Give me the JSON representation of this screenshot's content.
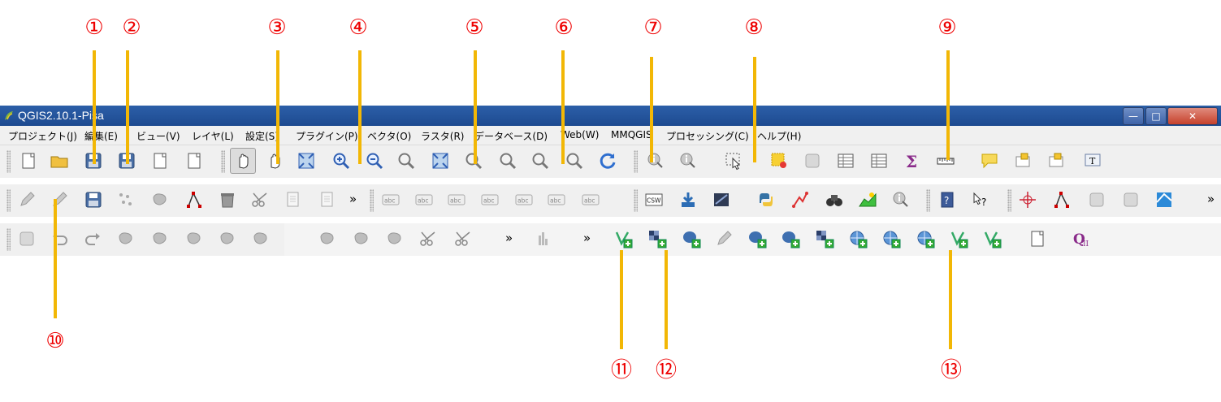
{
  "window": {
    "title": "QGIS2.10.1-Pisa",
    "controls": {
      "minimize": "—",
      "restore": "□",
      "close": "✕"
    }
  },
  "menubar": [
    "プロジェクト(J)",
    "編集(E)",
    "ビュー(V)",
    "レイヤ(L)",
    "設定(S)",
    "プラグイン(P)",
    "ベクタ(O)",
    "ラスタ(R)",
    "データベース(D)",
    "Web(W)",
    "MMQGIS",
    "プロセッシング(C)",
    "ヘルプ(H)"
  ],
  "callouts": {
    "top": [
      "①",
      "②",
      "③",
      "④",
      "⑤",
      "⑥",
      "⑦",
      "⑧",
      "⑨"
    ],
    "bottom": [
      "⑩",
      "⑪",
      "⑫",
      "⑬"
    ]
  },
  "toolbar": {
    "more_glyph": "»"
  },
  "icons": {
    "row1": [
      "new-project-icon",
      "open-project-icon",
      "save-project-icon",
      "save-as-icon",
      "new-print-composer-icon",
      "composer-manager-icon",
      "touch-zoom-icon",
      "pan-icon",
      "pan-to-selection-icon",
      "zoom-in-icon",
      "zoom-out-icon",
      "zoom-actual-icon",
      "zoom-full-icon",
      "zoom-to-selection-icon",
      "zoom-to-layer-icon",
      "zoom-last-icon",
      "zoom-next-icon",
      "refresh-icon",
      "identify-icon",
      "run-action-icon",
      "select-icon",
      "deselect-icon",
      "select-by-expression-icon",
      "attribute-table-icon",
      "field-calculator-icon",
      "statistics-icon",
      "measure-icon",
      "map-tips-icon",
      "new-bookmark-icon",
      "show-bookmarks-icon",
      "text-annotation-icon"
    ],
    "row2": [
      "edit-pencil-icon",
      "toggle-editing-icon",
      "save-edits-icon",
      "add-feature-icon",
      "move-feature-icon",
      "node-tool-icon",
      "delete-selected-icon",
      "cut-features-icon",
      "copy-features-icon",
      "paste-features-icon",
      "label-icon",
      "pin-label-icon",
      "highlight-pinned-icon",
      "show-hide-label-icon",
      "move-label-icon",
      "rotate-label-icon",
      "change-label-icon",
      "csw-icon",
      "ogr-converter-icon",
      "georeferencer-icon",
      "python-console-icon",
      "gps-tool-icon",
      "road-graph-icon",
      "profile-tool-icon",
      "qgis-identify-icon",
      "help-icon",
      "whats-this-icon",
      "coordinate-capture-icon",
      "spatial-query-icon",
      "offline-editing-icon",
      "topology-checker-icon",
      "grass-region-icon"
    ],
    "row3": [
      "digitize-ruler-icon",
      "undo-icon",
      "redo-icon",
      "simplify-feature-icon",
      "add-ring-icon",
      "add-part-icon",
      "fill-ring-icon",
      "delete-ring-icon",
      "delete-part-icon",
      "reshape-features-icon",
      "offset-curve-icon",
      "split-features-icon",
      "split-parts-icon",
      "merge-selected-icon",
      "histogram-icon",
      "add-vector-layer-icon",
      "add-raster-layer-icon",
      "add-postgis-layer-icon",
      "add-spatialite-layer-icon",
      "add-mssql-layer-icon",
      "add-oracle-layer-icon",
      "add-db2-layer-icon",
      "add-wms-layer-icon",
      "add-wcs-layer-icon",
      "add-wfs-layer-icon",
      "add-delimited-text-icon",
      "add-virtual-layer-icon",
      "new-shapefile-icon",
      "qi-plugin-icon"
    ]
  }
}
